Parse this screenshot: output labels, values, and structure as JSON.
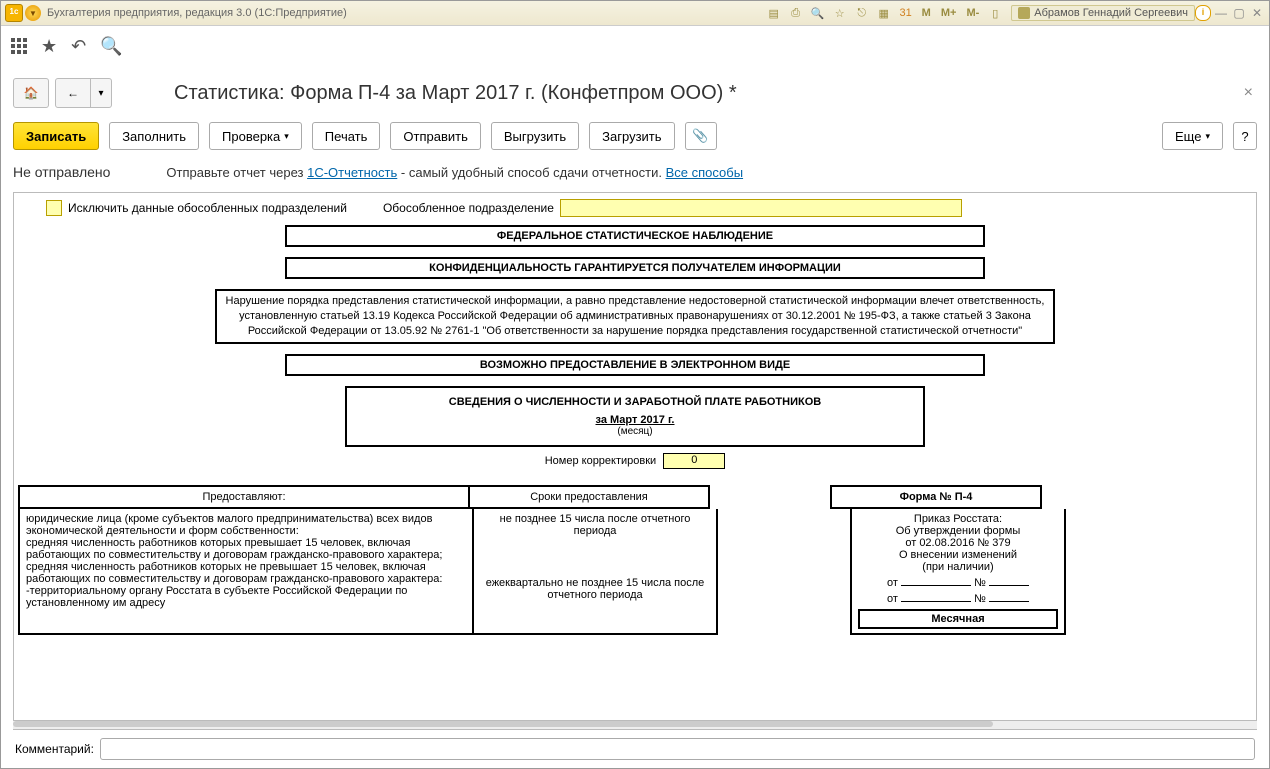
{
  "title": "Бухгалтерия предприятия, редакция 3.0  (1С:Предприятие)",
  "user": "Абрамов Геннадий Сергеевич",
  "m_buttons": [
    "M",
    "M+",
    "M-"
  ],
  "page_title": "Статистика: Форма П-4 за Март 2017 г. (Конфетпром ООО) *",
  "actions": {
    "write": "Записать",
    "fill": "Заполнить",
    "check": "Проверка",
    "print": "Печать",
    "send": "Отправить",
    "export": "Выгрузить",
    "import": "Загрузить",
    "more": "Еще",
    "help": "?"
  },
  "status": {
    "state": "Не отправлено",
    "prefix": "Отправьте отчет через ",
    "link1": "1С-Отчетность",
    "mid": " - самый удобный способ сдачи отчетности. ",
    "link2": "Все способы"
  },
  "filters": {
    "exclude": "Исключить данные обособленных подразделений",
    "separate": "Обособленное подразделение"
  },
  "form": {
    "h1": "ФЕДЕРАЛЬНОЕ СТАТИСТИЧЕСКОЕ НАБЛЮДЕНИЕ",
    "h2": "КОНФИДЕНЦИАЛЬНОСТЬ ГАРАНТИРУЕТСЯ ПОЛУЧАТЕЛЕМ ИНФОРМАЦИИ",
    "warn": "Нарушение порядка представления статистической информации, а равно представление недостоверной статистической информации влечет ответственность, установленную статьей 13.19 Кодекса Российской Федерации об административных правонарушениях от 30.12.2001 № 195-ФЗ, а также статьей 3 Закона Российской Федерации от 13.05.92 № 2761-1 \"Об ответственности за нарушение порядка представления государственной статистической отчетности\"",
    "electronic": "ВОЗМОЖНО ПРЕДОСТАВЛЕНИЕ В ЭЛЕКТРОННОМ ВИДЕ",
    "subject": "СВЕДЕНИЯ О ЧИСЛЕННОСТИ И ЗАРАБОТНОЙ ПЛАТЕ РАБОТНИКОВ",
    "period": "за Март 2017 г.",
    "period_caption": "(месяц)",
    "corr_label": "Номер корректировки",
    "corr_value": "0",
    "triple": {
      "c1": "Предоставляют:",
      "c2": "Сроки предоставления",
      "c3": "Форма № П-4"
    },
    "body1": "юридические лица (кроме субъектов малого предпринимательства) всех видов экономической деятельности и форм собственности:\n  средняя численность работников которых превышает 15 человек, включая работающих по совместительству и договорам гражданско-правового характера;\n средняя численность работников которых не превышает 15 человек, включая работающих по совместительству и договорам гражданско-правового характера:\n   -территориальному органу Росстата в субъекте Российской Федерации по установленному им адресу",
    "body2a": "не позднее 15 числа после отчетного периода",
    "body2b": "ежеквартально не позднее 15 числа после отчетного периода",
    "body3": {
      "l1": "Приказ Росстата:",
      "l2": "Об утверждении формы",
      "l3": "от 02.08.2016 № 379",
      "l4": "О внесении изменений",
      "l5": "(при наличии)",
      "ot": "от",
      "no": "№",
      "monthly": "Месячная"
    }
  },
  "comment_label": "Комментарий:"
}
